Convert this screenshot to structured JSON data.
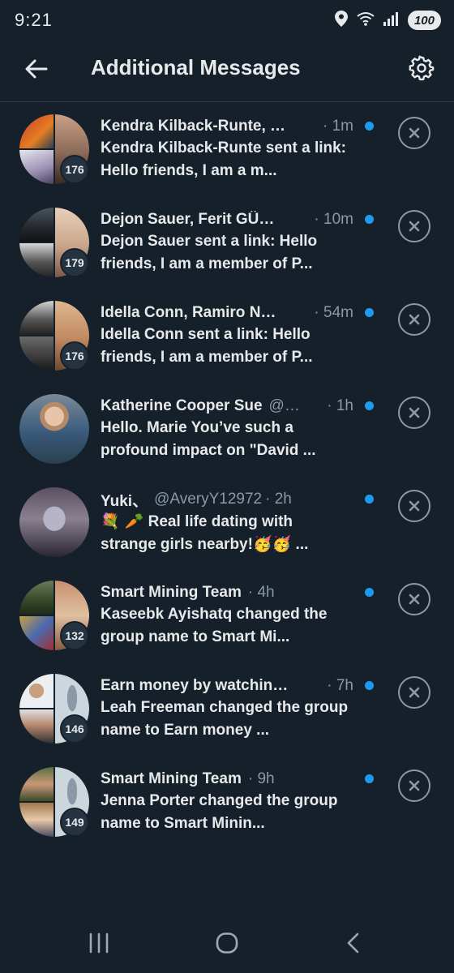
{
  "status_bar": {
    "time": "9:21",
    "battery": "100",
    "icons": [
      "location-icon",
      "wifi-icon",
      "signal-icon"
    ]
  },
  "header": {
    "title": "Additional Messages",
    "back_icon": "arrow-left-icon",
    "settings_icon": "gear-icon"
  },
  "accent_color": "#1d9bf0",
  "messages": [
    {
      "name": "Kendra Kilback-Runte, …",
      "handle": "",
      "time": "· 1m",
      "preview": "Kendra Kilback-Runte sent a link: Hello friends, I am a m...",
      "count": "176",
      "unread": true,
      "avatar_type": "group"
    },
    {
      "name": "Dejon Sauer, Ferit GÜ…",
      "handle": "",
      "time": "· 10m",
      "preview": "Dejon Sauer sent a link: Hello friends, I am a member of P...",
      "count": "179",
      "unread": true,
      "avatar_type": "group"
    },
    {
      "name": "Idella Conn, Ramiro N…",
      "handle": "",
      "time": "· 54m",
      "preview": "Idella Conn sent a link: Hello friends, I am a member of P...",
      "count": "176",
      "unread": true,
      "avatar_type": "group"
    },
    {
      "name": "Katherine Cooper Sue",
      "handle": "@…",
      "time": "· 1h",
      "preview": "Hello. Marie You’ve such a profound impact on \"David ...",
      "count": "",
      "unread": true,
      "avatar_type": "single"
    },
    {
      "name": "Yuki、",
      "handle": "@AveryY12972",
      "time": "· 2h",
      "preview_emoji": "💐 🥕",
      "preview": " Real life dating with strange girls nearby!🥳🥳 ...",
      "count": "",
      "unread": true,
      "avatar_type": "single"
    },
    {
      "name": "Smart Mining Team",
      "handle": "",
      "time": "· 4h",
      "preview": "Kaseebk Ayishatq changed the group name to Smart Mi...",
      "count": "132",
      "unread": true,
      "avatar_type": "group"
    },
    {
      "name": "Earn money by watchin…",
      "handle": "",
      "time": "· 7h",
      "preview": "Leah Freeman changed the group name to Earn money ...",
      "count": "146",
      "unread": true,
      "avatar_type": "group"
    },
    {
      "name": "Smart Mining Team",
      "handle": "",
      "time": "· 9h",
      "preview": "Jenna Porter changed the group name to Smart Minin...",
      "count": "149",
      "unread": true,
      "avatar_type": "group"
    }
  ],
  "nav_bar": {
    "recents_icon": "recents-icon",
    "home_icon": "home-icon",
    "back_icon": "back-chevron-icon"
  }
}
